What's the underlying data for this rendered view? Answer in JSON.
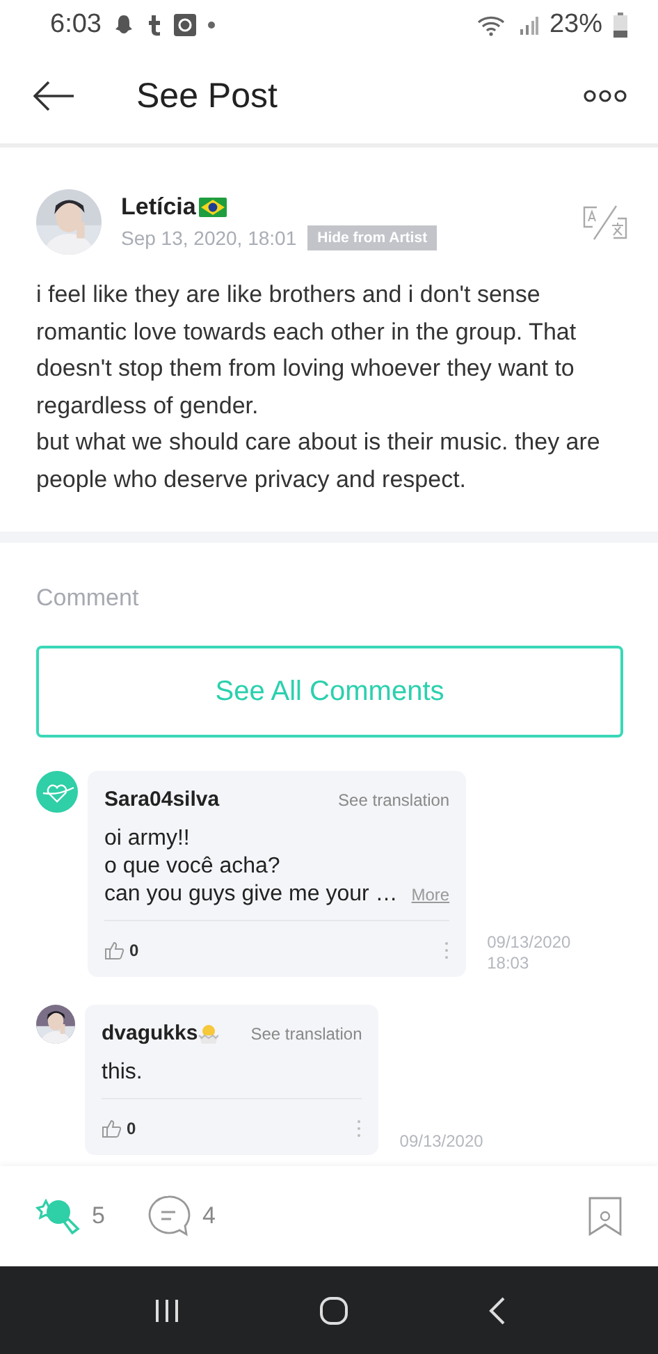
{
  "status_bar": {
    "time": "6:03",
    "battery": "23%"
  },
  "header": {
    "title": "See Post"
  },
  "post": {
    "author": "Letícia",
    "date": "Sep 13, 2020, 18:01",
    "badge": "Hide from Artist",
    "paragraphs": [
      "i feel like they are like brothers and i don't sense romantic love towards each other in the group. That doesn't stop them from loving whoever they want to regardless of gender.",
      "but what we should care about is their music. they are people who deserve privacy and respect."
    ]
  },
  "comment_section": {
    "label": "Comment",
    "see_all": "See All Comments",
    "comments": [
      {
        "author": "Sara04silva",
        "kind": "plain",
        "translate": "See translation",
        "lines": [
          "oi army!!",
          "o que você acha?",
          "can you guys give me your …"
        ],
        "more": "More",
        "likes": "0",
        "date": "09/13/2020",
        "time": "18:03"
      },
      {
        "author": "dvagukks",
        "translate": "See translation",
        "lines": [
          "this."
        ],
        "likes": "0",
        "date": "09/13/2020"
      }
    ]
  },
  "actions": {
    "cheers": "5",
    "comments": "4"
  }
}
